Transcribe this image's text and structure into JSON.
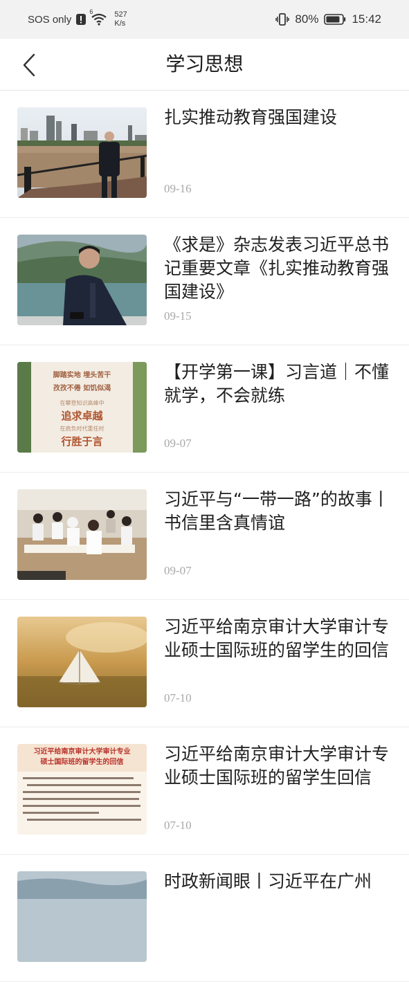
{
  "status_bar": {
    "carrier": "SOS only",
    "network_speed_value": "527",
    "network_speed_unit": "K/s",
    "battery_percent": "80%",
    "time": "15:42",
    "signal_badge": "6"
  },
  "header": {
    "title": "学习思想",
    "back_icon": "chevron-left-icon"
  },
  "articles": [
    {
      "title": "扎实推动教育强国建设",
      "date": "09-16"
    },
    {
      "title": "《求是》杂志发表习近平总书记重要文章《扎实推动教育强国建设》",
      "date": "09-15"
    },
    {
      "title": "【开学第一课】习言道｜不懂就学，不会就练",
      "date": "09-07"
    },
    {
      "title": "习近平与“一带一路”的故事丨书信里含真情谊",
      "date": "09-07"
    },
    {
      "title": "习近平给南京审计大学审计专业硕士国际班的留学生的回信",
      "date": "07-10"
    },
    {
      "title": "习近平给南京审计大学审计专业硕士国际班的留学生回信",
      "date": "07-10"
    },
    {
      "title": "时政新闻眼丨习近平在广州",
      "date": ""
    }
  ],
  "thumbnail_text": {
    "t3_line1": "脚踏实地 埋头苦干",
    "t3_line2": "孜孜不倦 如饥似渴",
    "t3_line3": "在攀登知识高峰中",
    "t3_line4": "追求卓越",
    "t3_line5": "在肩负时代重任时",
    "t3_line6": "行胜于言",
    "t6_heading1": "习近平给南京审计大学审计专业",
    "t6_heading2": "硕士国际班的留学生的回信"
  },
  "colors": {
    "status_bar_bg": "#f2f2f2",
    "divider": "#ececec",
    "date_text": "#a8a8a8",
    "thumb3_accent": "#c0392b"
  }
}
